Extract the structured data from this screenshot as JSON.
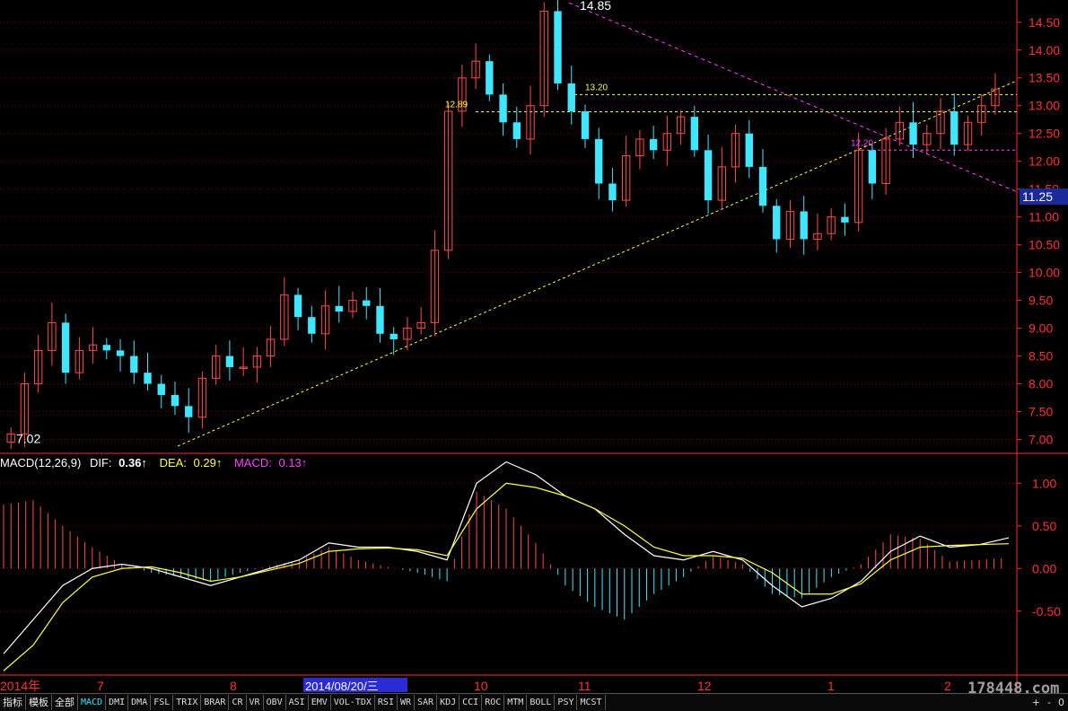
{
  "colors": {
    "up": "#ff4a4a",
    "down": "#3fe6ff",
    "dif": "#ffffff",
    "dea": "#ffff40",
    "macd": "#ff40ff",
    "axis": "#ff2a2a"
  },
  "indicator_header": {
    "name": "MACD(12,26,9)",
    "dif_label": "DIF:",
    "dif_value": "0.36↑",
    "dea_label": "DEA:",
    "dea_value": "0.29↑",
    "macd_label": "MACD:",
    "macd_value": "0.13↑"
  },
  "price_axis": {
    "ticks": [
      "14.50",
      "14.00",
      "13.50",
      "13.00",
      "12.50",
      "12.00",
      "11.50",
      "11.00",
      "10.50",
      "10.00",
      "9.50",
      "9.00",
      "8.50",
      "8.00",
      "7.50",
      "7.00"
    ],
    "current_price": "11.25"
  },
  "macd_axis": {
    "ticks": [
      "1.00",
      "0.50",
      "0.00",
      "-0.50"
    ]
  },
  "annotations": {
    "high_label": "14.85",
    "low_label": "7.02",
    "level_1320": "13.20",
    "level_1289": "12.89",
    "level_1220": "12.20"
  },
  "time_axis": {
    "labels": [
      "2014年",
      "7",
      "8",
      "2014/08/20/三",
      "10",
      "11",
      "12",
      "1",
      "2"
    ]
  },
  "watermark": "178448.com",
  "toolbar": {
    "tabs": [
      "指标",
      "模板",
      "全部",
      "MACD",
      "DMI",
      "DMA",
      "FSL",
      "TRIX",
      "BRAR",
      "CR",
      "VR",
      "OBV",
      "ASI",
      "EMV",
      "VOL-TDX",
      "RSI",
      "WR",
      "SAR",
      "KDJ",
      "CCI",
      "ROC",
      "MTM",
      "BOLL",
      "PSY",
      "MCST"
    ],
    "active": "MACD",
    "right_buttons": [
      "+",
      "-",
      "0"
    ]
  },
  "chart_data": [
    {
      "type": "candlestick",
      "ylim": [
        6.75,
        14.9
      ],
      "ticks": [
        7.0,
        7.5,
        8.0,
        8.5,
        9.0,
        9.5,
        10.0,
        10.5,
        11.0,
        11.5,
        12.0,
        12.5,
        13.0,
        13.5,
        14.0,
        14.5
      ],
      "current_price": 11.25,
      "high": 14.85,
      "low": 7.02,
      "levels": [
        13.2,
        12.89,
        12.2
      ],
      "close_series": [
        7.1,
        8.0,
        8.6,
        9.1,
        8.2,
        8.6,
        8.7,
        8.6,
        8.5,
        8.2,
        8.0,
        7.8,
        7.6,
        7.4,
        8.1,
        8.5,
        8.3,
        8.3,
        8.5,
        8.8,
        9.6,
        9.2,
        8.9,
        9.4,
        9.3,
        9.5,
        9.4,
        8.9,
        8.8,
        9.0,
        9.1,
        10.4,
        12.9,
        13.5,
        13.8,
        13.2,
        12.7,
        12.4,
        13.0,
        14.7,
        13.4,
        12.9,
        12.4,
        11.6,
        11.3,
        12.1,
        12.4,
        12.2,
        12.5,
        12.8,
        12.2,
        11.3,
        11.9,
        12.5,
        11.9,
        11.2,
        10.6,
        11.1,
        10.6,
        10.7,
        11.0,
        10.9,
        12.2,
        11.6,
        12.4,
        12.7,
        12.3,
        12.5,
        12.9,
        12.3,
        12.7,
        13.0,
        13.3
      ],
      "markers": [
        "7.02",
        "14.85",
        "13.20",
        "12.89",
        "12.20"
      ]
    },
    {
      "type": "line+bar",
      "name": "MACD(12,26,9)",
      "ylim": [
        -1.25,
        1.35
      ],
      "ticks": [
        1.0,
        0.5,
        0.0,
        -0.5
      ],
      "series": [
        {
          "name": "DIF",
          "values": [
            -1.0,
            -0.6,
            -0.2,
            0.0,
            0.05,
            0.0,
            -0.1,
            -0.2,
            -0.1,
            0.0,
            0.1,
            0.3,
            0.25,
            0.25,
            0.2,
            0.1,
            1.0,
            1.25,
            1.1,
            0.85,
            0.7,
            0.4,
            0.15,
            0.1,
            0.2,
            0.1,
            -0.2,
            -0.45,
            -0.35,
            -0.15,
            0.2,
            0.38,
            0.25,
            0.28,
            0.36
          ]
        },
        {
          "name": "DEA",
          "values": [
            -1.2,
            -0.9,
            -0.4,
            -0.1,
            0.0,
            0.02,
            -0.05,
            -0.15,
            -0.1,
            -0.02,
            0.06,
            0.2,
            0.23,
            0.24,
            0.22,
            0.15,
            0.7,
            1.0,
            0.95,
            0.85,
            0.7,
            0.5,
            0.25,
            0.15,
            0.15,
            0.12,
            -0.05,
            -0.3,
            -0.3,
            -0.18,
            0.1,
            0.25,
            0.27,
            0.28,
            0.29
          ]
        },
        {
          "name": "MACD",
          "values": [
            0.75,
            0.8,
            0.5,
            0.25,
            0.05,
            -0.05,
            -0.1,
            -0.15,
            -0.05,
            0.03,
            0.1,
            0.25,
            0.1,
            0.02,
            -0.05,
            -0.15,
            0.9,
            0.7,
            0.3,
            -0.2,
            -0.45,
            -0.6,
            -0.3,
            -0.1,
            0.15,
            0.05,
            -0.3,
            -0.35,
            -0.1,
            0.05,
            0.4,
            0.35,
            0.08,
            0.1,
            0.13
          ]
        }
      ]
    }
  ]
}
